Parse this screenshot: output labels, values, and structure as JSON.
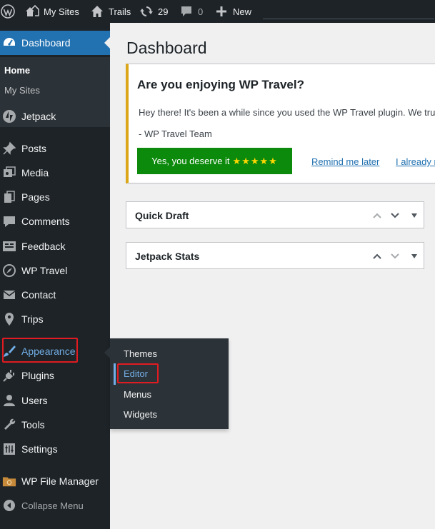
{
  "adminbar": {
    "logo_icon": "wordpress-logo-icon",
    "my_sites": "My Sites",
    "site_name": "Trails",
    "updates_count": "29",
    "comments_count": "0",
    "new_label": "New"
  },
  "sidebar": {
    "dashboard": "Dashboard",
    "home": "Home",
    "my_sites": "My Sites",
    "jetpack": "Jetpack",
    "posts": "Posts",
    "media": "Media",
    "pages": "Pages",
    "comments": "Comments",
    "feedback": "Feedback",
    "wp_travel": "WP Travel",
    "contact": "Contact",
    "trips": "Trips",
    "appearance": "Appearance",
    "plugins": "Plugins",
    "users": "Users",
    "tools": "Tools",
    "settings": "Settings",
    "file_manager": "WP File Manager",
    "collapse": "Collapse Menu"
  },
  "flyout": {
    "themes": "Themes",
    "editor": "Editor",
    "menus": "Menus",
    "widgets": "Widgets"
  },
  "main": {
    "title": "Dashboard",
    "notice": {
      "heading": "Are you enjoying WP Travel?",
      "message": "Hey there! It's been a while since you used the WP Travel plugin. We trus",
      "signature": "- WP Travel Team",
      "yes_label": "Yes, you deserve it",
      "stars": "★★★★★",
      "remind_label": "Remind me later",
      "already_label": "I already r"
    },
    "widgets": [
      {
        "title": "Quick Draft"
      },
      {
        "title": "Jetpack Stats"
      }
    ]
  },
  "colors": {
    "adminbar_bg": "#1d2327",
    "menu_current": "#2271b1",
    "highlight": "#e11b22",
    "notice_border": "#dba617",
    "button_green": "#0c8a0c"
  }
}
